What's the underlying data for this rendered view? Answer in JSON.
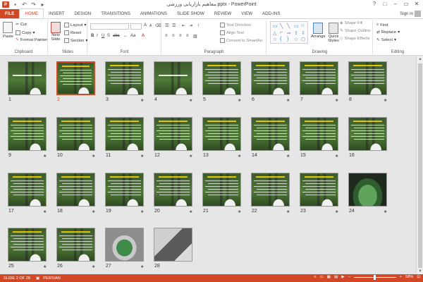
{
  "titlebar": {
    "title": "مفاهیم بازاریابی ورزشی.pptx - PowerPoint",
    "app_icon": "P",
    "qat": [
      "save-icon",
      "undo-icon",
      "redo-icon",
      "start-from-beginning-icon"
    ],
    "controls": [
      "?",
      "□",
      "–",
      "▭",
      "✕"
    ]
  },
  "tabs": [
    "FILE",
    "HOME",
    "INSERT",
    "DESIGN",
    "TRANSITIONS",
    "ANIMATIONS",
    "SLIDE SHOW",
    "REVIEW",
    "VIEW",
    "ADD-INS"
  ],
  "active_tab": "HOME",
  "signin": "Sign in",
  "ribbon": {
    "clipboard": {
      "paste": "Paste",
      "cut": "Cut",
      "copy": "Copy",
      "format_painter": "Format Painter",
      "label": "Clipboard"
    },
    "slides": {
      "new_slide": "New",
      "new_slide2": "Slide",
      "layout": "Layout",
      "reset": "Reset",
      "section": "Section",
      "label": "Slides"
    },
    "font": {
      "label": "Font"
    },
    "paragraph": {
      "text_direction": "Text Direction",
      "align_text": "Align Text",
      "convert_smartart": "Convert to SmartArt",
      "label": "Paragraph"
    },
    "drawing": {
      "arrange": "Arrange",
      "quick_styles": "Quick Styles",
      "shape_fill": "Shape Fill",
      "shape_outline": "Shape Outline",
      "shape_effects": "Shape Effects",
      "label": "Drawing"
    },
    "editing": {
      "find": "Find",
      "replace": "Replace",
      "select": "Select",
      "label": "Editing"
    }
  },
  "slides": [
    {
      "num": "1",
      "star": "",
      "kind": "title"
    },
    {
      "num": "2",
      "star": "",
      "kind": "text",
      "selected": true
    },
    {
      "num": "3",
      "star": "★",
      "kind": "text"
    },
    {
      "num": "4",
      "star": "★",
      "kind": "title"
    },
    {
      "num": "5",
      "star": "★",
      "kind": "text"
    },
    {
      "num": "6",
      "star": "★",
      "kind": "text"
    },
    {
      "num": "7",
      "star": "★",
      "kind": "text"
    },
    {
      "num": "8",
      "star": "★",
      "kind": "text"
    },
    {
      "num": "9",
      "star": "★",
      "kind": "text"
    },
    {
      "num": "10",
      "star": "★",
      "kind": "text"
    },
    {
      "num": "11",
      "star": "★",
      "kind": "text"
    },
    {
      "num": "12",
      "star": "★",
      "kind": "text"
    },
    {
      "num": "13",
      "star": "★",
      "kind": "text"
    },
    {
      "num": "14",
      "star": "★",
      "kind": "text"
    },
    {
      "num": "15",
      "star": "★",
      "kind": "text"
    },
    {
      "num": "16",
      "star": "",
      "kind": "text"
    },
    {
      "num": "17",
      "star": "★",
      "kind": "text"
    },
    {
      "num": "18",
      "star": "★",
      "kind": "text"
    },
    {
      "num": "19",
      "star": "★",
      "kind": "text"
    },
    {
      "num": "20",
      "star": "★",
      "kind": "text"
    },
    {
      "num": "21",
      "star": "★",
      "kind": "text"
    },
    {
      "num": "22",
      "star": "★",
      "kind": "text"
    },
    {
      "num": "23",
      "star": "★",
      "kind": "text"
    },
    {
      "num": "24",
      "star": "★",
      "kind": "stadium"
    },
    {
      "num": "25",
      "star": "★",
      "kind": "text"
    },
    {
      "num": "26",
      "star": "★",
      "kind": "text"
    },
    {
      "num": "27",
      "star": "★",
      "kind": "photo1"
    },
    {
      "num": "28",
      "star": "",
      "kind": "photo2"
    }
  ],
  "status": {
    "slide_of": "SLIDE 2 OF 28",
    "language": "PERSIAN",
    "zoom": "58%"
  },
  "colors": {
    "accent": "#d24726",
    "selection": "#d24726"
  }
}
